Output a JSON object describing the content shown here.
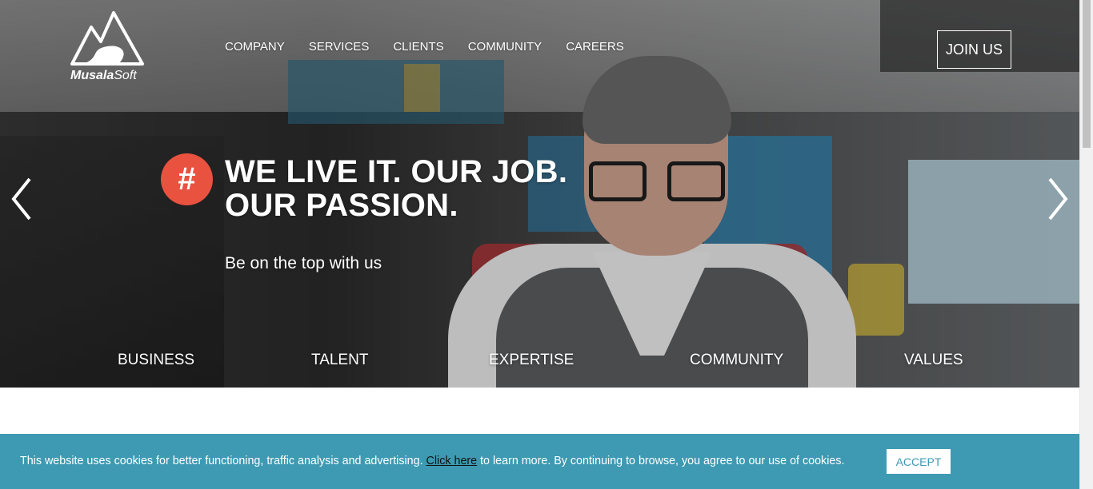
{
  "header": {
    "logo_bold": "Musala",
    "logo_light": "Soft",
    "nav": [
      {
        "label": "COMPANY"
      },
      {
        "label": "SERVICES"
      },
      {
        "label": "CLIENTS"
      },
      {
        "label": "COMMUNITY"
      },
      {
        "label": "CAREERS"
      }
    ],
    "join_label": "JOIN US"
  },
  "hero": {
    "badge": "#",
    "headline_line1": "WE LIVE IT. OUR JOB.",
    "headline_line2": "OUR PASSION.",
    "subline": "Be on the top with us",
    "tabs": [
      {
        "label": "BUSINESS"
      },
      {
        "label": "TALENT"
      },
      {
        "label": "EXPERTISE"
      },
      {
        "label": "COMMUNITY"
      },
      {
        "label": "VALUES"
      }
    ]
  },
  "cookie": {
    "text_before": "This website uses cookies for better functioning, traffic analysis and advertising. ",
    "link": "Click here",
    "text_after": " to learn more. By continuing to browse, you agree to our use of cookies.",
    "accept_label": "ACCEPT"
  },
  "colors": {
    "accent": "#e9523f",
    "cookie_bar": "#3d9ab2"
  },
  "icons": {
    "prev": "chevron-left-icon",
    "next": "chevron-right-icon",
    "logo": "mountain-logo-icon"
  }
}
